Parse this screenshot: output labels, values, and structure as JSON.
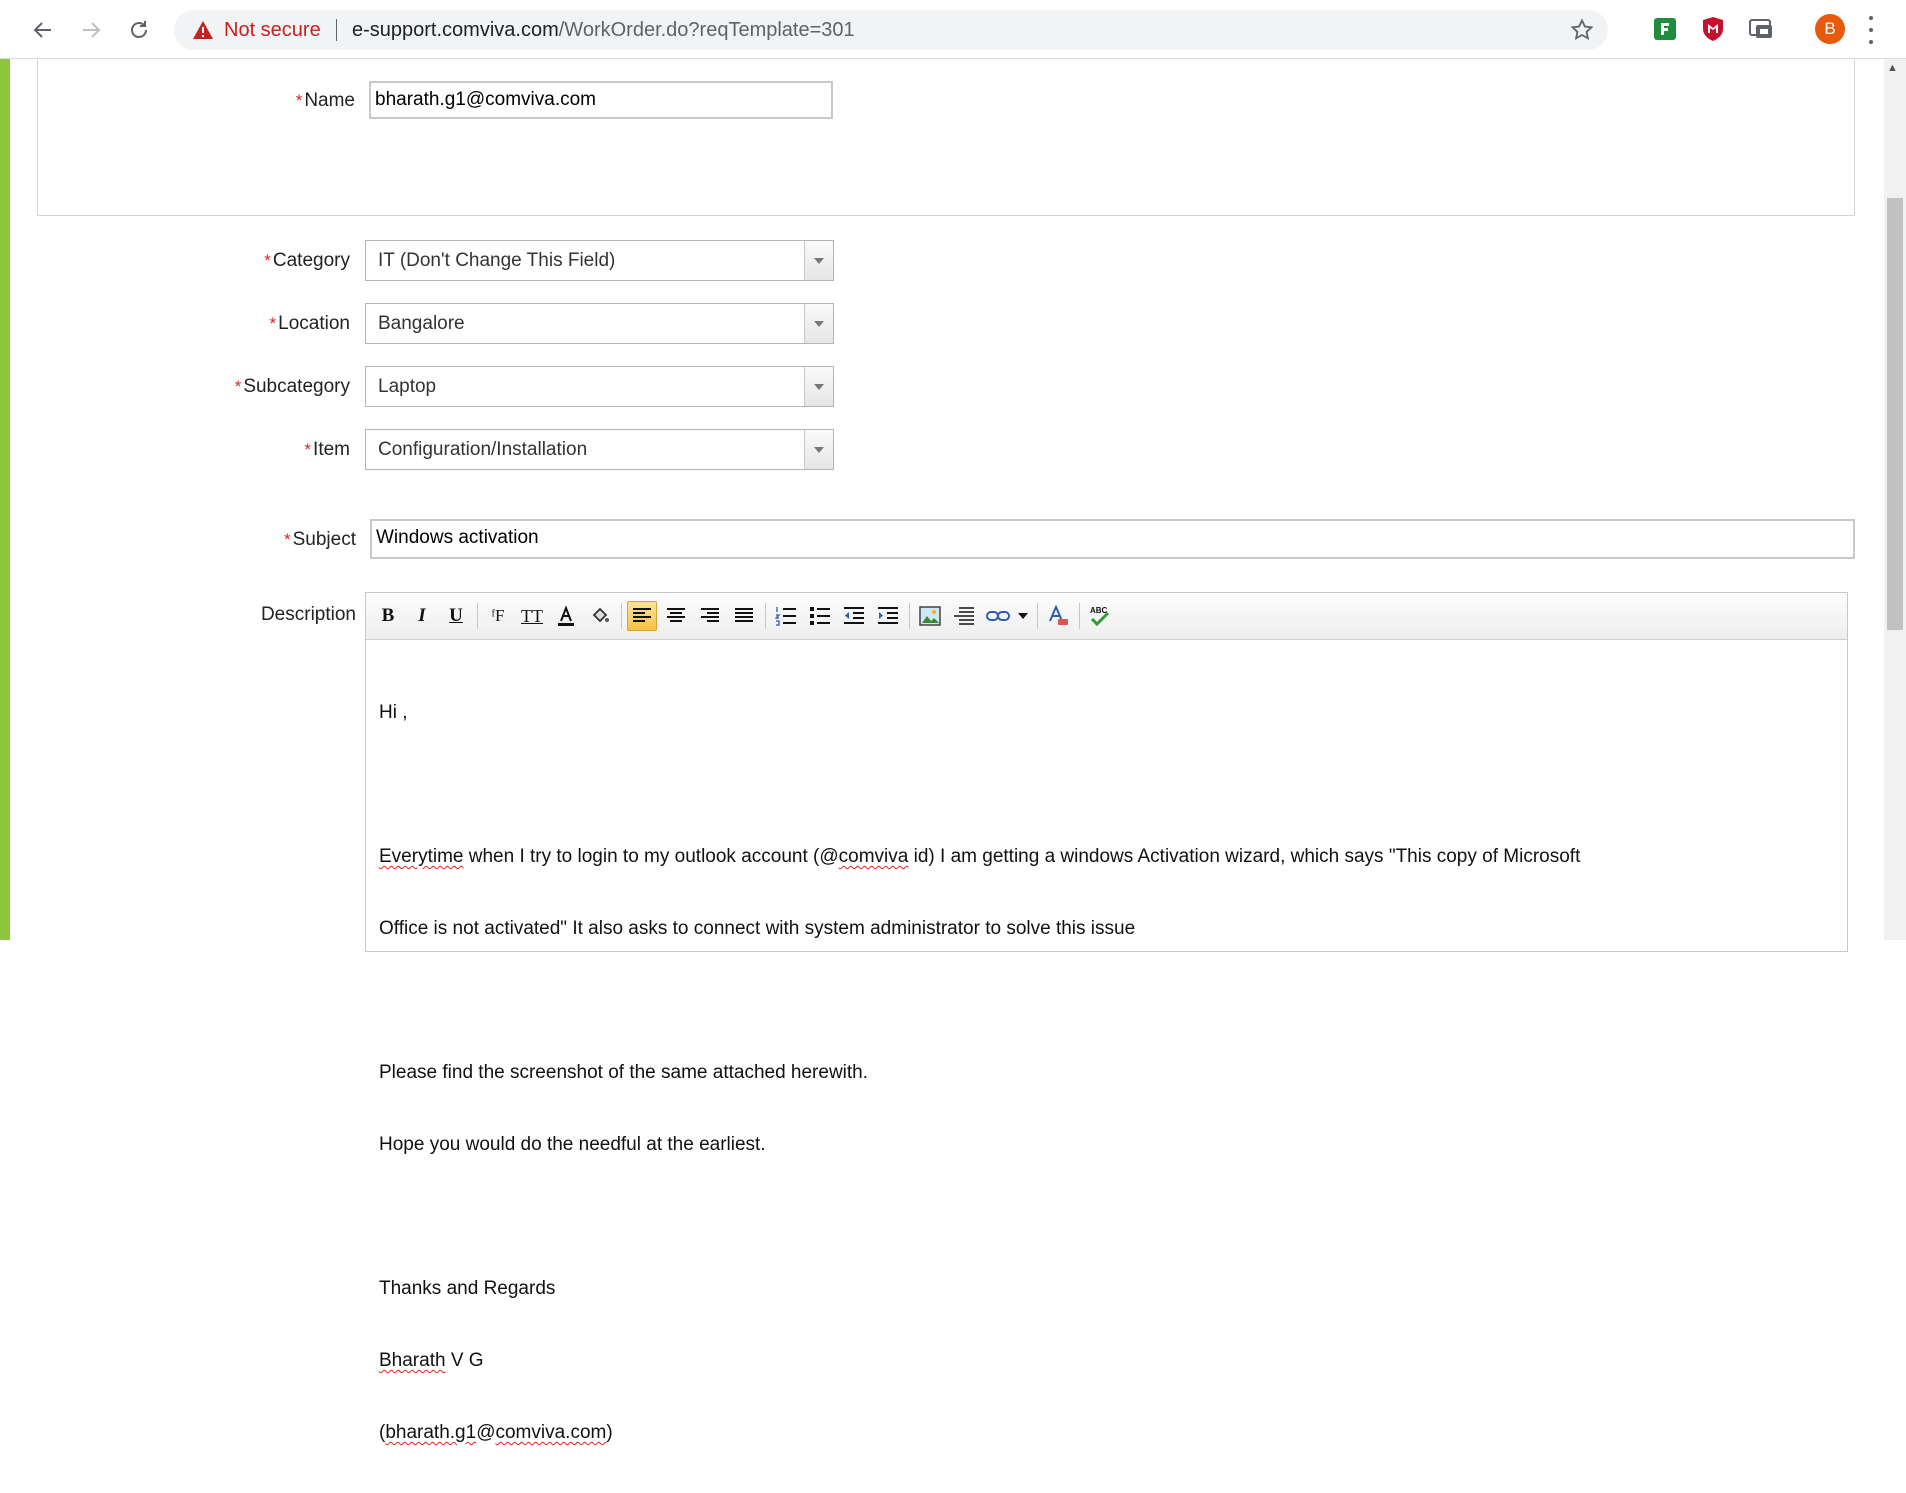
{
  "browser": {
    "security_label": "Not secure",
    "url_host": "e-support.comviva.com",
    "url_path": "/WorkOrder.do?reqTemplate=301",
    "profile_initial": "B",
    "icons": [
      "back-arrow-icon",
      "forward-arrow-icon",
      "reload-icon",
      "warning-triangle-icon",
      "bookmark-star-icon",
      "extension-green-icon",
      "extension-shield-icon",
      "extension-cast-icon",
      "menu-dots-icon"
    ]
  },
  "requester": {
    "name_label": "Name",
    "name_value": "bharath.g1@comviva.com"
  },
  "form": {
    "category_label": "Category",
    "category_value": "IT (Don't Change This Field)",
    "location_label": "Location",
    "location_value": "Bangalore",
    "subcategory_label": "Subcategory",
    "subcategory_value": "Laptop",
    "item_label": "Item",
    "item_value": "Configuration/Installation",
    "subject_label": "Subject",
    "subject_value": "Windows activation",
    "description_label": "Description",
    "required_marker": "*"
  },
  "editor": {
    "toolbar": [
      "bold",
      "italic",
      "underline",
      "font-family",
      "font-size",
      "font-color",
      "background-color",
      "align-left",
      "align-center",
      "align-right",
      "justify",
      "ordered-list",
      "unordered-list",
      "outdent",
      "indent",
      "insert-image",
      "horizontal-rule",
      "insert-link",
      "more",
      "remove-format",
      "spellcheck"
    ],
    "lines": {
      "greeting": "Hi ,",
      "l1_a": "Everytime",
      "l1_b": " when I try to login to my outlook account (@",
      "l1_c": "comviva",
      "l1_d": " id) I am getting a windows Activation wizard, which says \"This copy of Microsoft",
      "l2": "Office is not activated\" It also asks to connect with system administrator to solve this issue",
      "l3": "Please find the screenshot of the same attached herewith.",
      "l4": "Hope you would do the needful at the earliest.",
      "l5": "Thanks and Regards",
      "l6_a": "Bharath",
      "l6_b": " V G",
      "l7_a": "(",
      "l7_b": "bharath.g1",
      "l7_c": "@",
      "l7_d": "comviva.com",
      "l7_e": ")"
    }
  },
  "colors": {
    "required": "#e02020",
    "left_strip": "#8dc63f",
    "security_red": "#c5221f",
    "active_button": "#f7c046"
  }
}
